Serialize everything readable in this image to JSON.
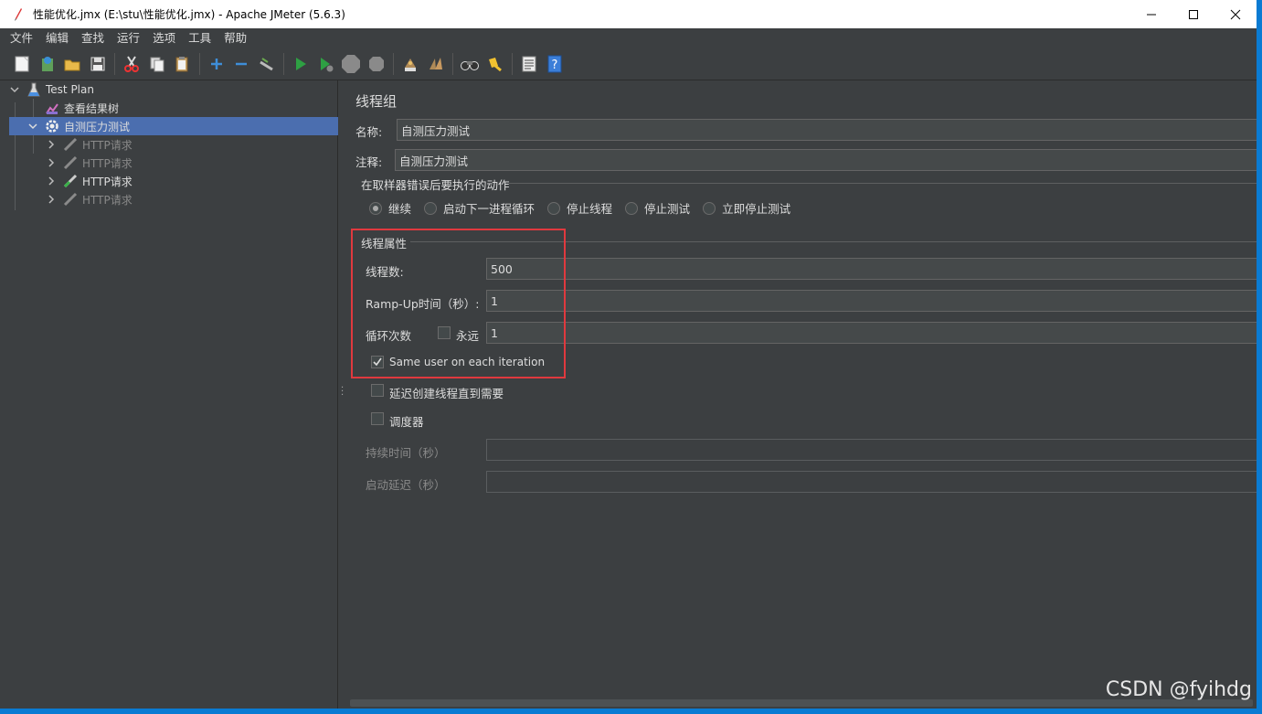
{
  "window": {
    "title": "性能优化.jmx (E:\\stu\\性能优化.jmx) - Apache JMeter (5.6.3)",
    "controls": [
      "minimize-icon",
      "maximize-icon",
      "close-icon"
    ]
  },
  "menu": [
    "文件",
    "编辑",
    "查找",
    "运行",
    "选项",
    "工具",
    "帮助"
  ],
  "toolbar": {
    "icons": [
      "new-icon",
      "templates-icon",
      "open-icon",
      "save-icon",
      "cut-icon",
      "copy-icon",
      "paste-icon",
      "expand-icon",
      "collapse-icon",
      "toggle-icon",
      "start-icon",
      "start-no-pause-icon",
      "stop-icon",
      "shutdown-icon",
      "clear-icon",
      "clear-all-icon",
      "search-icon",
      "reset-search-icon",
      "function-helper-icon",
      "help-icon"
    ]
  },
  "tree": {
    "nodes": [
      {
        "label": "Test Plan",
        "icon": "test-plan-icon",
        "enabled": true
      },
      {
        "label": "查看结果树",
        "icon": "results-tree-icon",
        "enabled": true
      },
      {
        "label": "自测压力测试",
        "icon": "thread-group-gear-icon",
        "enabled": true,
        "selected": true
      },
      {
        "label": "HTTP请求",
        "icon": "pipette-icon",
        "enabled": false
      },
      {
        "label": "HTTP请求",
        "icon": "pipette-icon",
        "enabled": false
      },
      {
        "label": "HTTP请求",
        "icon": "pipette-icon",
        "enabled": true
      },
      {
        "label": "HTTP请求",
        "icon": "pipette-icon",
        "enabled": false
      }
    ]
  },
  "panel": {
    "title": "线程组",
    "name_label": "名称:",
    "name_value": "自测压力测试",
    "comment_label": "注释:",
    "comment_value": "自测压力测试",
    "error_action": {
      "title": "在取样器错误后要执行的动作",
      "options": [
        "继续",
        "启动下一进程循环",
        "停止线程",
        "停止测试",
        "立即停止测试"
      ],
      "selected": "继续"
    },
    "thread_props": {
      "title": "线程属性",
      "threads_label": "线程数:",
      "threads_value": "500",
      "rampup_label": "Ramp-Up时间（秒）:",
      "rampup_value": "1",
      "loop_label": "循环次数",
      "forever_label": "永远",
      "forever_checked": false,
      "loop_value": "1",
      "same_user_label": "Same user on each iteration",
      "same_user_checked": true
    },
    "delay_label": "延迟创建线程直到需要",
    "delay_checked": false,
    "scheduler_label": "调度器",
    "scheduler_checked": false,
    "duration_label": "持续时间（秒）",
    "duration_value": "",
    "startup_delay_label": "启动延迟（秒）",
    "startup_delay_value": ""
  },
  "watermark": "CSDN @fyihdg",
  "colors": {
    "background": "#3c3f41",
    "selection": "#4b6eaf",
    "highlight_box": "#e0393e",
    "desktop": "#0a7bd3"
  }
}
